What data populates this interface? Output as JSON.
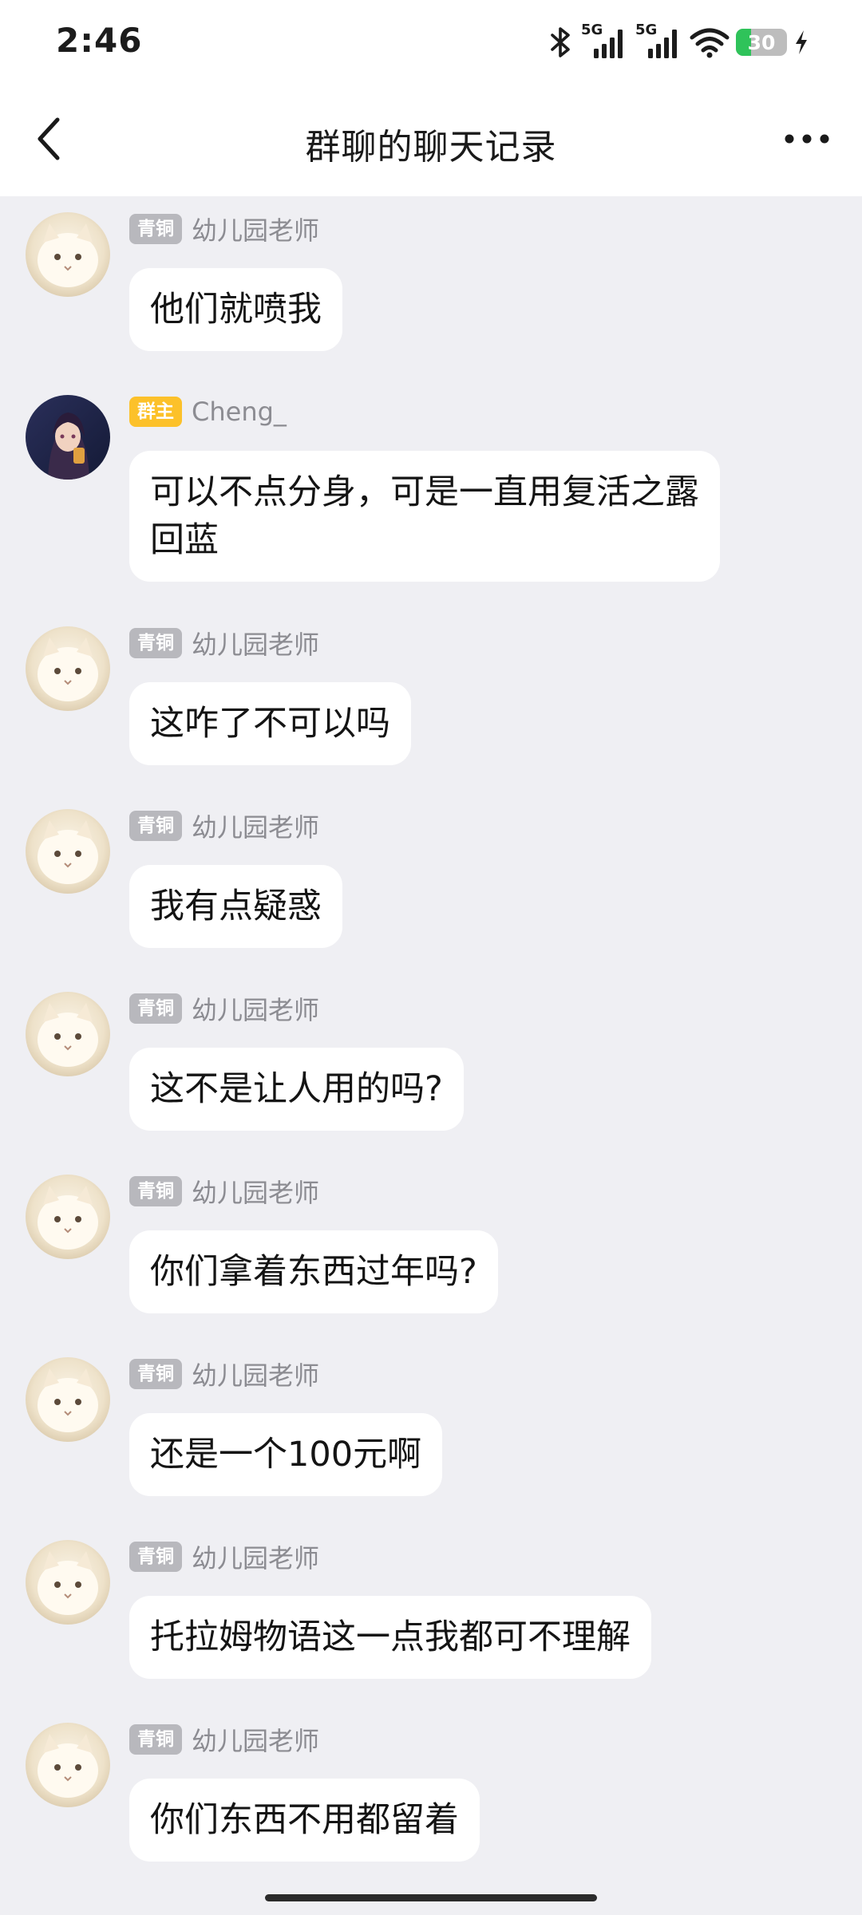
{
  "status_bar": {
    "time": "2:46",
    "network_1": "5G",
    "network_2": "5G",
    "battery_level": "30",
    "battery_color": "#2fc35a",
    "icons": [
      "bluetooth-icon",
      "signal-icon",
      "signal-icon",
      "wifi-icon",
      "battery-icon",
      "charging-icon"
    ]
  },
  "header": {
    "title": "群聊的聊天记录",
    "back_icon": "chevron-left-icon",
    "more_icon": "more-dots-icon"
  },
  "badges": {
    "bronze_color": "#b8b8bd",
    "owner_color": "#fcc12a"
  },
  "messages": [
    {
      "badge": "青铜",
      "sender": "幼儿园老师",
      "text": "他们就喷我",
      "avatar": "cat-avatar"
    },
    {
      "badge": "群主",
      "sender": "Cheng_",
      "text": "可以不点分身，可是一直用复活之露回蓝",
      "avatar": "anime-avatar"
    },
    {
      "badge": "青铜",
      "sender": "幼儿园老师",
      "text": "这咋了不可以吗",
      "avatar": "cat-avatar"
    },
    {
      "badge": "青铜",
      "sender": "幼儿园老师",
      "text": "我有点疑惑",
      "avatar": "cat-avatar"
    },
    {
      "badge": "青铜",
      "sender": "幼儿园老师",
      "text": "这不是让人用的吗?",
      "avatar": "cat-avatar"
    },
    {
      "badge": "青铜",
      "sender": "幼儿园老师",
      "text": "你们拿着东西过年吗?",
      "avatar": "cat-avatar"
    },
    {
      "badge": "青铜",
      "sender": "幼儿园老师",
      "text": "还是一个100元啊",
      "avatar": "cat-avatar"
    },
    {
      "badge": "青铜",
      "sender": "幼儿园老师",
      "text": "托拉姆物语这一点我都可不理解",
      "avatar": "cat-avatar"
    },
    {
      "badge": "青铜",
      "sender": "幼儿园老师",
      "text": "你们东西不用都留着",
      "avatar": "cat-avatar"
    }
  ]
}
